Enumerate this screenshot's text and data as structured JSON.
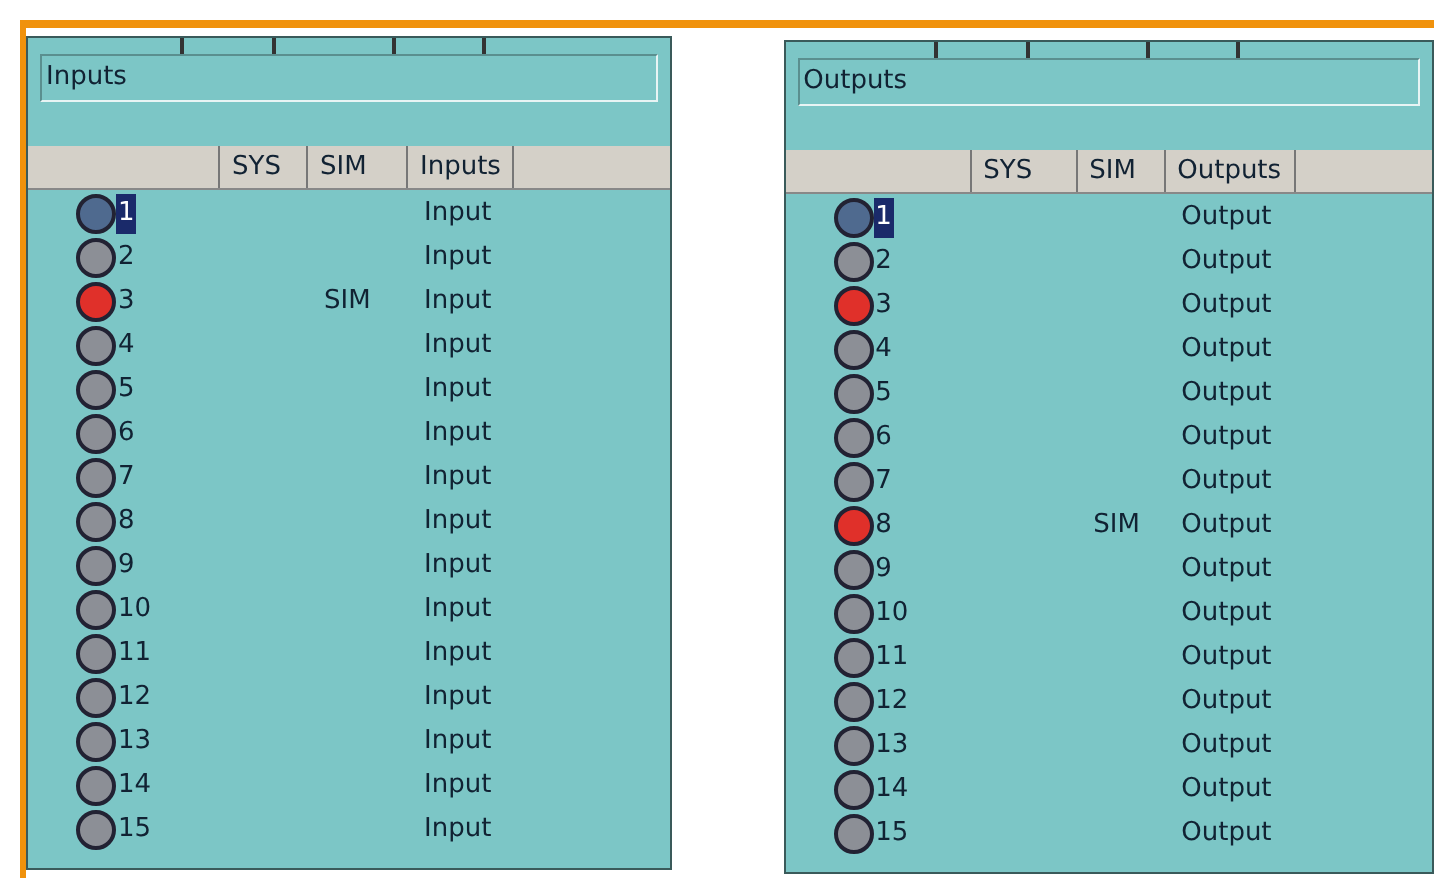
{
  "panels": [
    {
      "title": "Inputs",
      "columns": [
        "SYS",
        "SIM",
        "Inputs"
      ],
      "rows": [
        {
          "number": "1",
          "color": "#4f6a8f",
          "selected": true,
          "text": "Input"
        },
        {
          "number": "2",
          "color": "#8c8f96",
          "selected": false,
          "text": "Input"
        },
        {
          "number": "3",
          "color": "#e0302a",
          "selected": false,
          "sim": "SIM",
          "text": "Input"
        },
        {
          "number": "4",
          "color": "#8c8f96",
          "selected": false,
          "text": "Input"
        },
        {
          "number": "5",
          "color": "#8c8f96",
          "selected": false,
          "text": "Input"
        },
        {
          "number": "6",
          "color": "#8c8f96",
          "selected": false,
          "text": "Input"
        },
        {
          "number": "7",
          "color": "#8c8f96",
          "selected": false,
          "text": "Input"
        },
        {
          "number": "8",
          "color": "#8c8f96",
          "selected": false,
          "text": "Input"
        },
        {
          "number": "9",
          "color": "#8c8f96",
          "selected": false,
          "text": "Input"
        },
        {
          "number": "10",
          "color": "#8c8f96",
          "selected": false,
          "text": "Input"
        },
        {
          "number": "11",
          "color": "#8c8f96",
          "selected": false,
          "text": "Input"
        },
        {
          "number": "12",
          "color": "#8c8f96",
          "selected": false,
          "text": "Input"
        },
        {
          "number": "13",
          "color": "#8c8f96",
          "selected": false,
          "text": "Input"
        },
        {
          "number": "14",
          "color": "#8c8f96",
          "selected": false,
          "text": "Input"
        },
        {
          "number": "15",
          "color": "#8c8f96",
          "selected": false,
          "text": "Input"
        }
      ]
    },
    {
      "title": "Outputs",
      "columns": [
        "SYS",
        "SIM",
        "Outputs"
      ],
      "rows": [
        {
          "number": "1",
          "color": "#4f6a8f",
          "selected": true,
          "text": "Output"
        },
        {
          "number": "2",
          "color": "#8c8f96",
          "selected": false,
          "text": "Output"
        },
        {
          "number": "3",
          "color": "#e0302a",
          "selected": false,
          "text": "Output"
        },
        {
          "number": "4",
          "color": "#8c8f96",
          "selected": false,
          "text": "Output"
        },
        {
          "number": "5",
          "color": "#8c8f96",
          "selected": false,
          "text": "Output"
        },
        {
          "number": "6",
          "color": "#8c8f96",
          "selected": false,
          "text": "Output"
        },
        {
          "number": "7",
          "color": "#8c8f96",
          "selected": false,
          "text": "Output"
        },
        {
          "number": "8",
          "color": "#e0302a",
          "selected": false,
          "sim": "SIM",
          "text": "Output"
        },
        {
          "number": "9",
          "color": "#8c8f96",
          "selected": false,
          "text": "Output"
        },
        {
          "number": "10",
          "color": "#8c8f96",
          "selected": false,
          "text": "Output"
        },
        {
          "number": "11",
          "color": "#8c8f96",
          "selected": false,
          "text": "Output"
        },
        {
          "number": "12",
          "color": "#8c8f96",
          "selected": false,
          "text": "Output"
        },
        {
          "number": "13",
          "color": "#8c8f96",
          "selected": false,
          "text": "Output"
        },
        {
          "number": "14",
          "color": "#8c8f96",
          "selected": false,
          "text": "Output"
        },
        {
          "number": "15",
          "color": "#8c8f96",
          "selected": false,
          "text": "Output"
        }
      ]
    }
  ]
}
